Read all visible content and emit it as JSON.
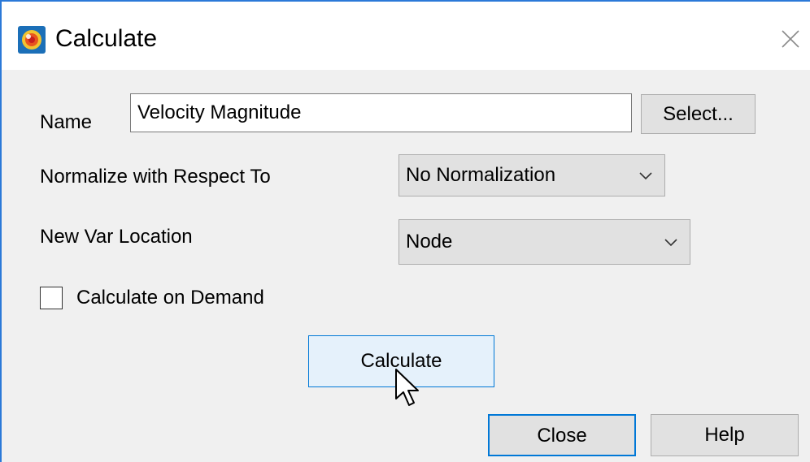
{
  "window": {
    "title": "Calculate",
    "app_icon": "tecplot-app-icon",
    "close_icon": "close-icon",
    "border_color": "#2b79d8"
  },
  "form": {
    "name_label": "Name",
    "name_value": "Velocity Magnitude",
    "select_button": "Select...",
    "normalize_label": "Normalize with Respect To",
    "normalize_value": "No Normalization",
    "location_label": "New Var Location",
    "location_value": "Node",
    "on_demand_label": "Calculate on Demand",
    "on_demand_checked": false
  },
  "buttons": {
    "calculate": "Calculate",
    "close": "Close",
    "help": "Help"
  },
  "colors": {
    "dialog_bg": "#f0f0f0",
    "button_bg": "#e1e1e1",
    "button_hover_bg": "#e5f1fb",
    "focus_border": "#0078d7"
  },
  "cursor": "arrow-pointer-icon"
}
